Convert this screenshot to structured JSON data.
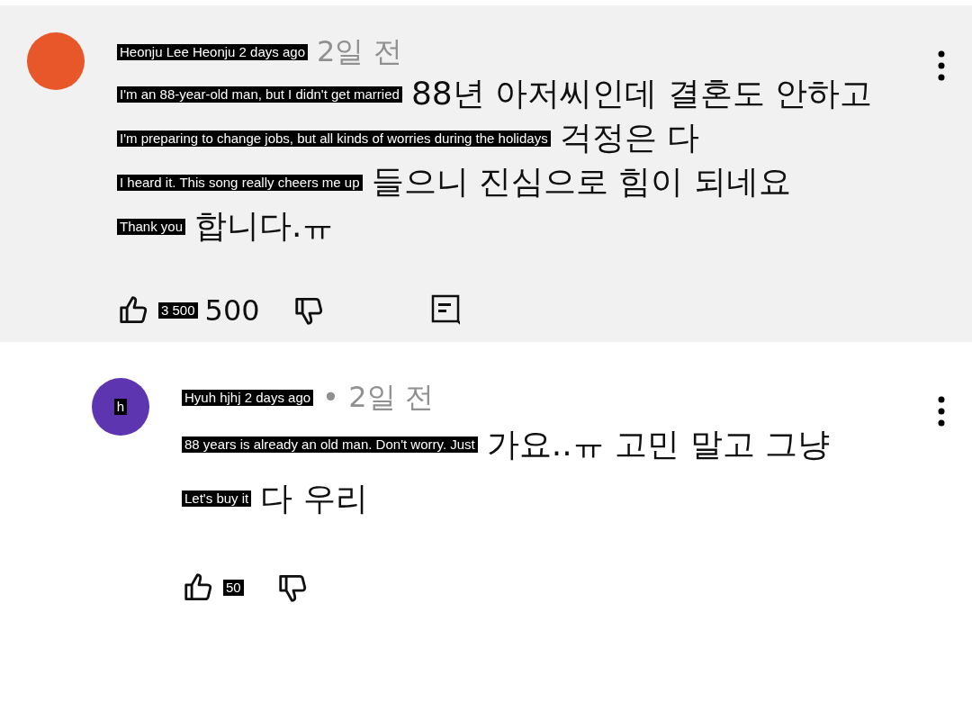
{
  "comments": [
    {
      "highlighted": true,
      "avatar": {
        "color": "#e8572a"
      },
      "header": {
        "translation": "Heonju Lee Heonju 2 days ago",
        "text": "2일 전"
      },
      "lines": [
        {
          "translation": "I'm an 88-year-old man, but I didn't get married",
          "text": "88년 아저씨인데 결혼도 안하고"
        },
        {
          "translation": "I'm preparing to change jobs, but all kinds of worries during the holidays",
          "text": "걱정은 다"
        },
        {
          "translation": "I heard it. This song really cheers me up",
          "text": "들으니 진심으로 힘이 되네요"
        },
        {
          "translation": "Thank you",
          "text": "합니다.ㅠ"
        }
      ],
      "likes": {
        "translation": "3 500",
        "count": "500"
      },
      "reply_button": true
    },
    {
      "highlighted": false,
      "avatar": {
        "color": "#5e35b1",
        "translation": "h"
      },
      "header": {
        "translation": "Hyuh hjhj 2 days ago",
        "text": "• 2일 전"
      },
      "lines": [
        {
          "translation": "88 years is already an old man. Don't worry. Just",
          "text": "가요..ㅠ 고민 말고 그냥"
        },
        {
          "translation": "Let's buy it",
          "text": "다 우리"
        }
      ],
      "likes": {
        "translation": "50"
      },
      "reply_button": false
    }
  ]
}
